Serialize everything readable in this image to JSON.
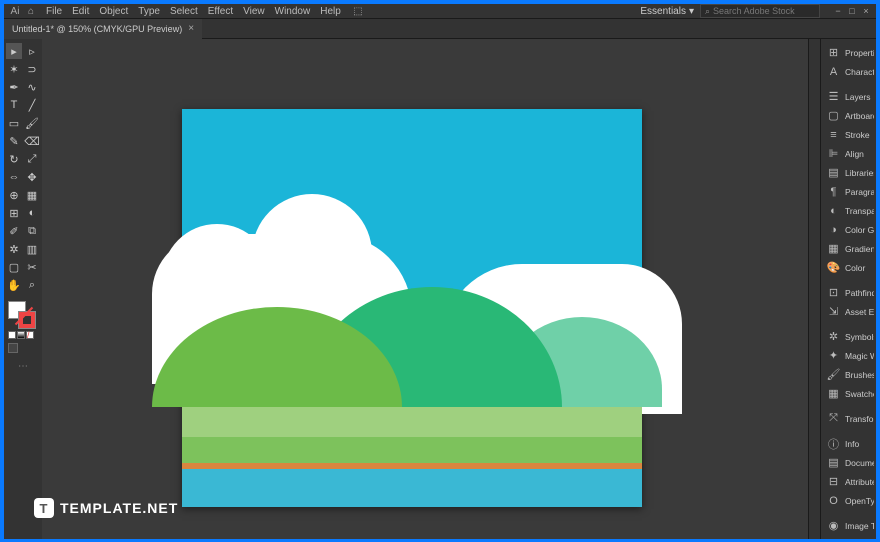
{
  "menu": {
    "file": "File",
    "edit": "Edit",
    "object": "Object",
    "type": "Type",
    "select": "Select",
    "effect": "Effect",
    "view": "View",
    "window": "Window",
    "help": "Help"
  },
  "workspace": "Essentials",
  "search_placeholder": "Search Adobe Stock",
  "tab": {
    "title": "Untitled-1* @ 150% (CMYK/GPU Preview)",
    "close": "×"
  },
  "panels": {
    "properties": "Properties",
    "character": "Character",
    "layers": "Layers",
    "artboards": "Artboards",
    "stroke": "Stroke",
    "align": "Align",
    "libraries": "Libraries",
    "paragraph": "Paragraph",
    "transparency": "Transparency",
    "colorguide": "Color Guide",
    "gradient": "Gradient",
    "color": "Color",
    "pathfinder": "Pathfinder",
    "assetexport": "Asset Export",
    "symbols": "Symbols",
    "magicwand": "Magic Wand",
    "brushes": "Brushes",
    "swatches": "Swatches",
    "transform": "Transform",
    "info": "Info",
    "documentinfo": "Document I...",
    "attributes": "Attributes",
    "opentype": "OpenType",
    "imagetrace": "Image Trace"
  },
  "watermark": "TEMPLATE.NET"
}
